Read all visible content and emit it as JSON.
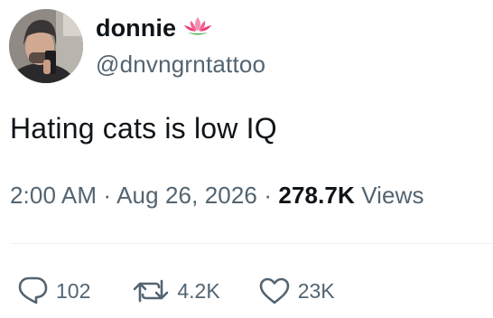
{
  "author": {
    "display_name": "donnie",
    "handle": "@dnvngrntattoo",
    "name_emoji": "lotus-icon"
  },
  "tweet": {
    "text": "Hating cats is low IQ",
    "time": "2:00 AM",
    "separator": "·",
    "date": "Aug 26, 2026",
    "views_count": "278.7K",
    "views_label": "Views"
  },
  "actions": {
    "reply": {
      "icon": "reply-icon",
      "count": "102"
    },
    "retweet": {
      "icon": "retweet-icon",
      "count": "4.2K"
    },
    "like": {
      "icon": "heart-icon",
      "count": "23K"
    }
  },
  "colors": {
    "text_primary": "#0f1419",
    "text_secondary": "#536471",
    "divider": "#eff3f4",
    "lotus": "#f06292"
  }
}
